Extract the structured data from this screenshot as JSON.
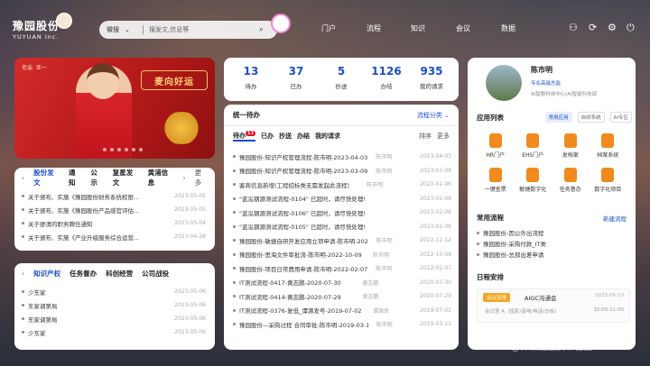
{
  "brand": {
    "name_cn": "豫园股份",
    "name_en": "YUYUAN Inc."
  },
  "search": {
    "scope": "微搜",
    "placeholder": "搜发文,信息等"
  },
  "nav": [
    "门户",
    "流程",
    "知识",
    "会议",
    "数据"
  ],
  "banner": {
    "tags": [
      "老庙",
      "亚一"
    ],
    "sign": "麦向好运"
  },
  "news_tabs": [
    "股份发文",
    "通知",
    "公示",
    "复星发文",
    "黄浦信息"
  ],
  "more": "更多",
  "news": [
    {
      "t": "关于颁布、实施《豫园股份财务系统权限...",
      "d": "2023-05-05"
    },
    {
      "t": "关于颁布、实施《豫园股份产品感官评估...",
      "d": "2023-05-05"
    },
    {
      "t": "关于廖清的职务聘任通知",
      "d": "2023-05-04"
    },
    {
      "t": "关于颁布、实施《产业升级服务综合运营...",
      "d": "2023-04-28"
    },
    {
      "t": "关于颁布、实施《豫园股份员工伙伴计划...",
      "d": "2023-04-24"
    }
  ],
  "kb_tabs": [
    "知识产权",
    "任务督办",
    "科创经营",
    "公司战役"
  ],
  "kb": [
    {
      "t": "少东家",
      "d": "2023-05-06"
    },
    {
      "t": "东家调第局",
      "d": "2023-05-06"
    },
    {
      "t": "东家调第局",
      "d": "2023-05-06"
    },
    {
      "t": "少东家",
      "d": "2023-05-06"
    }
  ],
  "stats": [
    {
      "n": "13",
      "l": "待办"
    },
    {
      "n": "37",
      "l": "已办"
    },
    {
      "n": "5",
      "l": "抄送"
    },
    {
      "n": "1126",
      "l": "办结"
    },
    {
      "n": "935",
      "l": "我的请求"
    }
  ],
  "todo": {
    "title": "统一待办",
    "filter": "流程分类",
    "tabs": [
      "待办",
      "已办",
      "抄送",
      "办结",
      "我的请求"
    ],
    "badge": "13",
    "sort": "排序",
    "more": "更多"
  },
  "todo_rows": [
    {
      "t": "豫园股份-知识产权管理流程-陈市明-2023-04-03",
      "w": "陈市明",
      "d": "2023-04-03"
    },
    {
      "t": "豫园股份-知识产权管理流程-陈市明-2023-03-09",
      "w": "陈市明",
      "d": "2023-03-09"
    },
    {
      "t": "客商信息新增(工程招标类无需发起此流程)",
      "w": "陈市明",
      "d": "2023-02-06"
    },
    {
      "t": "\"蓝泓钢源测试流程-0104\" 已超时，请尽快处理!",
      "w": "",
      "d": "2023-02-06"
    },
    {
      "t": "\"蓝泓钢源测试流程-0106\" 已超时，请尽快处理!",
      "w": "",
      "d": "2023-02-06"
    },
    {
      "t": "\"蓝泓钢源测试流程-0105\" 已超时，请尽快处理!",
      "w": "",
      "d": "2023-02-06"
    },
    {
      "t": "豫园股份-敏捷自研开发应用立项申请-陈市明-2022...",
      "w": "陈市明",
      "d": "2022-12-12"
    },
    {
      "t": "豫园股份-思海文件审批流-陈市明-2022-10-09",
      "w": "陈市明",
      "d": "2022-10-09"
    },
    {
      "t": "豫园股份-项目日常费用申请-陈市明-2022-02-07",
      "w": "陈市明",
      "d": "2022-02-07"
    },
    {
      "t": "IT测试流程-0417-黄志鹏-2020-07-30",
      "w": "黄志鹏",
      "d": "2020-07-30"
    },
    {
      "t": "IT测试流程-0414-黄志鹏-2020-07-29",
      "w": "黄志鹏",
      "d": "2020-07-29"
    },
    {
      "t": "IT测试流程-0376-复低_谭源发号-2019-07-02",
      "w": "谭源发",
      "d": "2019-07-02"
    },
    {
      "t": "豫园股份—采购过程 合同审批-陈市明-2019-03-11",
      "w": "陈市明",
      "d": "2019-03-11"
    }
  ],
  "profile": {
    "name": "陈市明",
    "tag": "专业高级总监",
    "dept": "AI智数科技中心/AI智能科技部"
  },
  "apps": {
    "title": "应用列表",
    "tabs": [
      "常用应用",
      "自研系统",
      "AI专区"
    ],
    "items": [
      "HR门户",
      "EHS门户",
      "发档案",
      "档案系统",
      "一键查票",
      "敏捷数字化",
      "任务督办",
      "数字化项目"
    ]
  },
  "flows": {
    "title": "常用流程",
    "new": "新建流程",
    "items": [
      "豫园股份-因公外出流程",
      "豫园股份-采购付款_IT类",
      "豫园股份-总部出差申请"
    ]
  },
  "schedule": {
    "title": "日程安排",
    "tag": "会议安排",
    "event": "AIGC沟通会",
    "date": "2023-05-10",
    "loc": "会议室 A（投影/音响/电话/白板）",
    "time": "10:00-11:00"
  },
  "watermark": "@稀土掘金技术社区"
}
